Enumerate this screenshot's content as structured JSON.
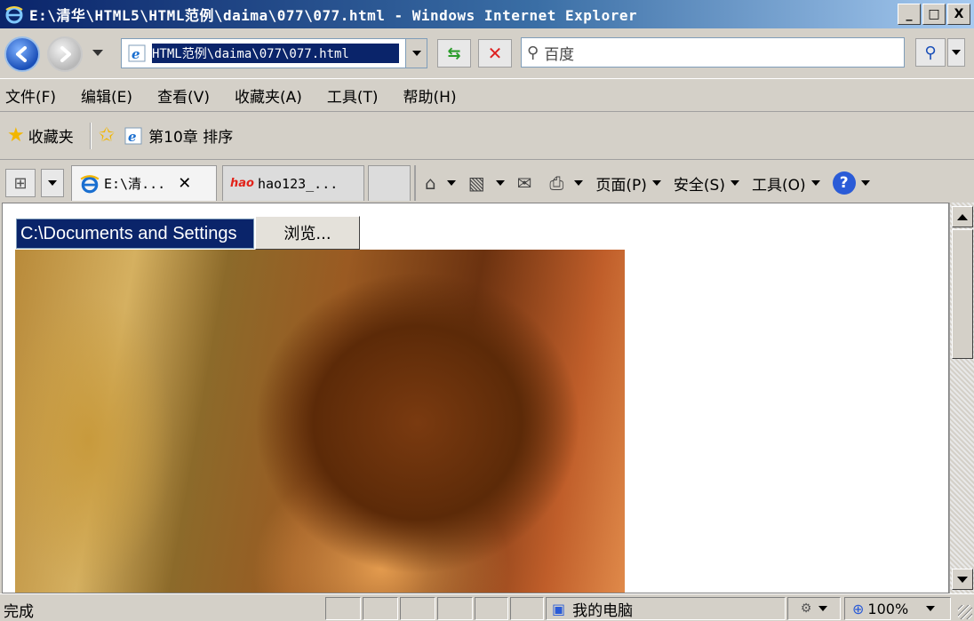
{
  "window": {
    "title": "E:\\清华\\HTML5\\HTML范例\\daima\\077\\077.html - Windows Internet Explorer",
    "minimize": "_",
    "maximize": "□",
    "close": "X"
  },
  "addressbar": {
    "url": "HTML范例\\daima\\077\\077.html",
    "search_placeholder": "百度"
  },
  "menu": {
    "items": [
      "文件(F)",
      "编辑(E)",
      "查看(V)",
      "收藏夹(A)",
      "工具(T)",
      "帮助(H)"
    ]
  },
  "favorites": {
    "label": "收藏夹",
    "links": [
      "第10章 排序"
    ]
  },
  "tabs": [
    {
      "label": "E:\\清...",
      "active": true
    },
    {
      "label": "hao123_...",
      "active": false,
      "site_logo": "hao"
    }
  ],
  "commandbar": {
    "page": "页面(P)",
    "safety": "安全(S)",
    "tools": "工具(O)",
    "help": "?"
  },
  "content": {
    "file_input_value": "C:\\Documents and Settings",
    "browse_label": "浏览..."
  },
  "statusbar": {
    "text": "完成",
    "zone": "我的电脑",
    "zoom": "100%"
  },
  "icons": [
    "back-icon",
    "forward-icon",
    "ie-page-icon",
    "refresh-icon",
    "stop-icon",
    "search-icon",
    "star-icon",
    "add-favorite-icon",
    "quick-tabs-icon",
    "home-icon",
    "feeds-icon",
    "mail-icon",
    "print-icon",
    "help-icon",
    "computer-icon",
    "zoom-icon"
  ]
}
